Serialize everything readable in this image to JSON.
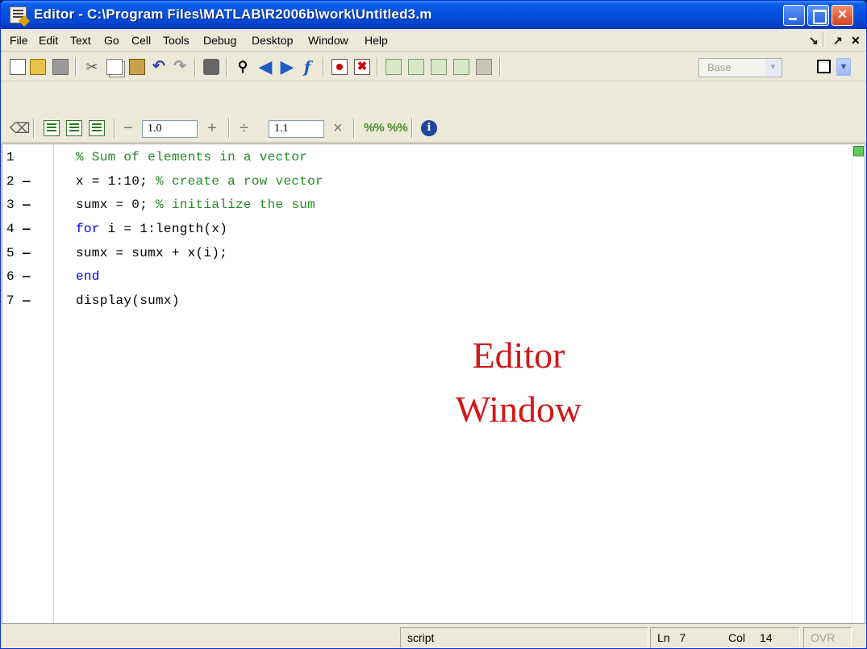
{
  "window": {
    "title": "Editor - C:\\Program Files\\MATLAB\\R2006b\\work\\Untitled3.m"
  },
  "menu": [
    "File",
    "Edit",
    "Text",
    "Go",
    "Cell",
    "Tools",
    "Debug",
    "Desktop",
    "Window",
    "Help"
  ],
  "toolbar": {
    "workspace_combo": "Base"
  },
  "cell_toolbar": {
    "decrement_value": "1.0",
    "divide_value": "1.1"
  },
  "editor": {
    "line_numbers": [
      "1",
      "2",
      "3",
      "4",
      "5",
      "6",
      "7"
    ],
    "lines": [
      {
        "code": "",
        "comment": "% Sum of elements in a vector",
        "keyword": ""
      },
      {
        "code": "x = 1:10; ",
        "comment": "% create a row vector",
        "keyword": ""
      },
      {
        "code": "sumx = 0; ",
        "comment": "% initialize the sum",
        "keyword": ""
      },
      {
        "code": " i = 1:length(x)",
        "comment": "",
        "keyword": "for"
      },
      {
        "code": "sumx = sumx + x(i);",
        "comment": "",
        "keyword": ""
      },
      {
        "code": "",
        "comment": "",
        "keyword": "end"
      },
      {
        "code": "display(sumx)",
        "comment": "",
        "keyword": ""
      }
    ],
    "annotation_line1": "Editor",
    "annotation_line2": "Window"
  },
  "status": {
    "mode": "script",
    "ln_label": "Ln",
    "ln_value": "7",
    "col_label": "Col",
    "col_value": "14",
    "ovr": "OVR"
  }
}
